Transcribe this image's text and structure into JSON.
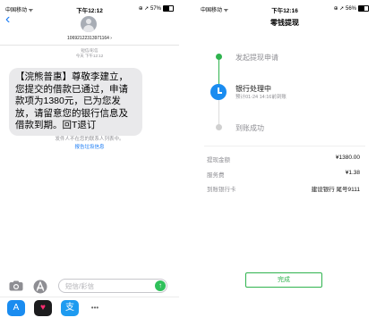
{
  "sms": {
    "status": {
      "carrier": "中国移动",
      "time": "下午12:12",
      "right": "57%"
    },
    "contact_number": "10692122313971164 ›",
    "message_type": "短信/彩信",
    "message_time": "今天 下午12:12",
    "message_text": "【浣熊普惠】尊敬李建立，您提交的借款已通过，申请款项为1380元，已为您发放，请留意您的银行信息及借款到期。回T退订",
    "unknown_sender_text": "发件人不在您的联系人列表中。",
    "report_junk_label": "报告垃圾信息",
    "input_placeholder": "短信/彩信",
    "send_glyph": "↑",
    "apps": [
      "A",
      "♥",
      "支",
      "•••"
    ]
  },
  "withdraw": {
    "status": {
      "carrier": "中国移动",
      "time": "下午12:16",
      "right": "56%"
    },
    "title": "零钱提现",
    "steps": [
      {
        "label": "发起提现申请",
        "state": "done"
      },
      {
        "label": "银行处理中",
        "sub": "预计01-24 14:16前到账",
        "state": "current"
      },
      {
        "label": "到账成功",
        "state": "pending"
      }
    ],
    "details": [
      {
        "label": "提现金额",
        "value": "¥1380.00"
      },
      {
        "label": "服务费",
        "value": "¥1.38"
      },
      {
        "label": "到账银行卡",
        "value": "建设银行 尾号9111"
      }
    ],
    "done_label": "完成"
  },
  "colors": {
    "ios_blue": "#1a7cf5",
    "wechat_green": "#2fb34e",
    "bubble_gray": "#e9e9eb"
  }
}
